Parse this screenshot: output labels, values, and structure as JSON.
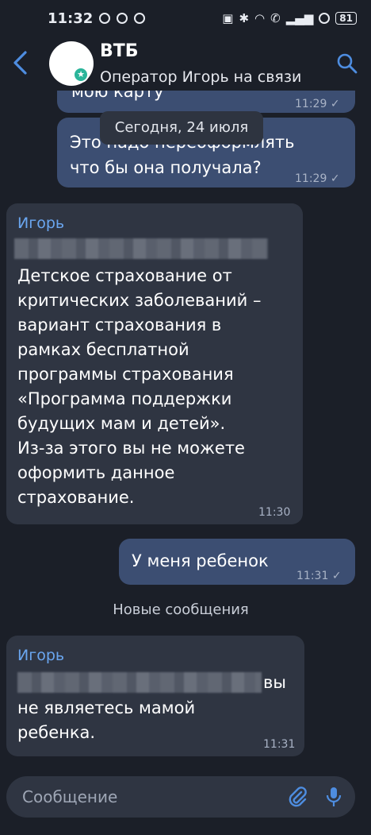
{
  "status_bar": {
    "time": "11:32",
    "battery": "81"
  },
  "header": {
    "title": "ВТБ",
    "subtitle": "Оператор Игорь на связи"
  },
  "date_separator": "Сегодня, 24 июля",
  "messages": [
    {
      "direction": "outgoing",
      "text_partial": "мою карту",
      "time": "11:29",
      "status": "read"
    },
    {
      "direction": "outgoing",
      "line1": "Это надо переоформлять",
      "line2": "что бы она получала?",
      "time": "11:29",
      "status": "read"
    },
    {
      "direction": "incoming",
      "sender": "Игорь",
      "lines": [
        "Детское страхование от",
        "критических заболеваний –",
        "вариант страхования в",
        "рамках бесплатной",
        "программы страхования",
        "«Программа поддержки",
        "будущих мам и детей».",
        "Из-за этого вы не можете",
        "оформить данное",
        "страхование."
      ],
      "time": "11:30"
    },
    {
      "direction": "outgoing",
      "text": "У меня ребенок",
      "time": "11:31",
      "status": "read"
    },
    {
      "direction": "incoming",
      "sender": "Игорь",
      "line1_end": "вы",
      "line2": "не являетесь мамой",
      "line3": "ребенка.",
      "time": "11:31"
    }
  ],
  "new_messages_label": "Новые сообщения",
  "composer": {
    "placeholder": "Сообщение"
  },
  "icons": {
    "back": "back-arrow-icon",
    "search": "search-icon",
    "attach": "paperclip-icon",
    "mic": "microphone-icon",
    "verified": "star-badge-icon"
  },
  "colors": {
    "background": "#1b1f28",
    "outgoing_bubble": "#3c4e72",
    "incoming_bubble": "#2f3542",
    "accent": "#4e8de0",
    "sender_name": "#6aa6f0"
  }
}
